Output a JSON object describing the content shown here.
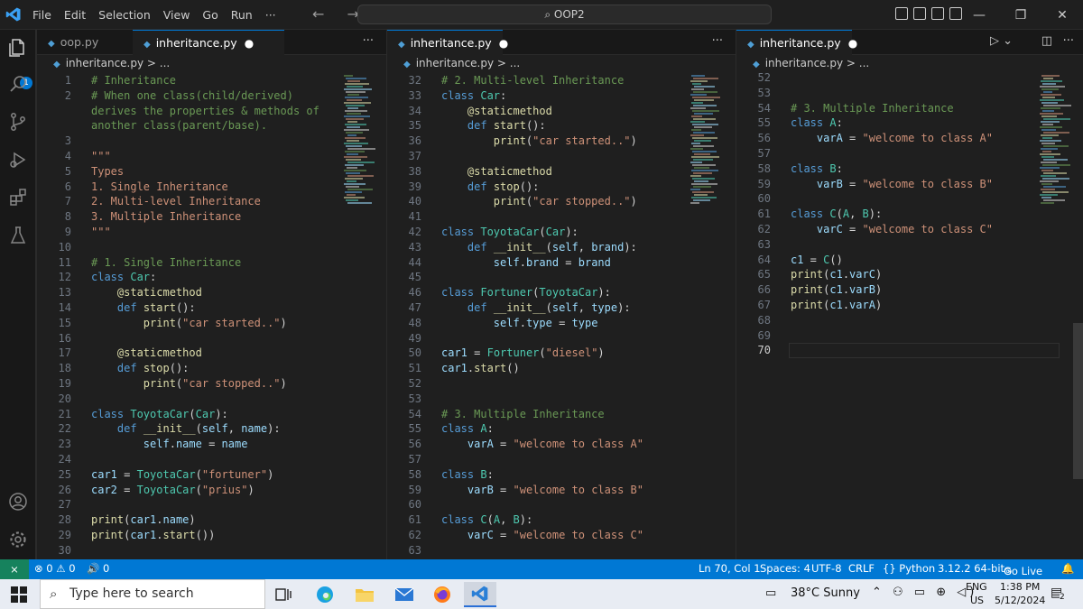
{
  "titlebar": {
    "menu": [
      "File",
      "Edit",
      "Selection",
      "View",
      "Go",
      "Run",
      "···"
    ],
    "search_text": "OOP2",
    "nav_arrows": "← →",
    "window_controls": [
      "—",
      "❐",
      "✕"
    ]
  },
  "activity_bar": {
    "explorer_badge": "1",
    "icons": [
      "files-icon",
      "search-icon",
      "source-control-icon",
      "run-debug-icon",
      "extensions-icon",
      "testing-icon",
      "account-icon",
      "settings-gear-icon"
    ]
  },
  "groups": [
    {
      "tabs": [
        {
          "label": "oop.py",
          "active": false,
          "dirty": false
        },
        {
          "label": "inheritance.py",
          "active": true,
          "dirty": true
        }
      ],
      "breadcrumb": "inheritance.py > ..."
    },
    {
      "tabs": [
        {
          "label": "inheritance.py",
          "active": true,
          "dirty": true
        }
      ],
      "breadcrumb": "inheritance.py > ..."
    },
    {
      "tabs": [
        {
          "label": "inheritance.py",
          "active": true,
          "dirty": true
        }
      ],
      "breadcrumb": "inheritance.py > ..."
    }
  ],
  "editor1_lines": [
    {
      "n": "1",
      "t": [
        [
          "c-cmt",
          "# Inheritance"
        ]
      ]
    },
    {
      "n": "2",
      "t": [
        [
          "c-cmt",
          "# When one class(child/derived)"
        ]
      ]
    },
    {
      "n": "",
      "t": [
        [
          "c-cmt",
          "derives the properties & methods of"
        ]
      ]
    },
    {
      "n": "",
      "t": [
        [
          "c-cmt",
          "another class(parent/base)."
        ]
      ]
    },
    {
      "n": "3",
      "t": []
    },
    {
      "n": "4",
      "t": [
        [
          "c-str",
          "\"\"\""
        ]
      ]
    },
    {
      "n": "5",
      "t": [
        [
          "c-str",
          "Types"
        ]
      ]
    },
    {
      "n": "6",
      "t": [
        [
          "c-str",
          "1. Single Inheritance"
        ]
      ]
    },
    {
      "n": "7",
      "t": [
        [
          "c-str",
          "2. Multi-level Inheritance"
        ]
      ]
    },
    {
      "n": "8",
      "t": [
        [
          "c-str",
          "3. Multiple Inheritance"
        ]
      ]
    },
    {
      "n": "9",
      "t": [
        [
          "c-str",
          "\"\"\""
        ]
      ]
    },
    {
      "n": "10",
      "t": []
    },
    {
      "n": "11",
      "t": [
        [
          "c-cmt",
          "# 1. Single Inheritance"
        ]
      ]
    },
    {
      "n": "12",
      "t": [
        [
          "c-kw",
          "class "
        ],
        [
          "c-cls",
          "Car"
        ],
        [
          "c-txt",
          ":"
        ]
      ]
    },
    {
      "n": "13",
      "t": [
        [
          "c-txt",
          "    "
        ],
        [
          "c-dec",
          "@staticmethod"
        ]
      ]
    },
    {
      "n": "14",
      "t": [
        [
          "c-txt",
          "    "
        ],
        [
          "c-kw",
          "def "
        ],
        [
          "c-fn",
          "start"
        ],
        [
          "c-txt",
          "():"
        ]
      ]
    },
    {
      "n": "15",
      "t": [
        [
          "c-txt",
          "        "
        ],
        [
          "c-fn",
          "print"
        ],
        [
          "c-txt",
          "("
        ],
        [
          "c-str",
          "\"car started..\""
        ],
        [
          "c-txt",
          ")"
        ]
      ]
    },
    {
      "n": "16",
      "t": []
    },
    {
      "n": "17",
      "t": [
        [
          "c-txt",
          "    "
        ],
        [
          "c-dec",
          "@staticmethod"
        ]
      ]
    },
    {
      "n": "18",
      "t": [
        [
          "c-txt",
          "    "
        ],
        [
          "c-kw",
          "def "
        ],
        [
          "c-fn",
          "stop"
        ],
        [
          "c-txt",
          "():"
        ]
      ]
    },
    {
      "n": "19",
      "t": [
        [
          "c-txt",
          "        "
        ],
        [
          "c-fn",
          "print"
        ],
        [
          "c-txt",
          "("
        ],
        [
          "c-str",
          "\"car stopped..\""
        ],
        [
          "c-txt",
          ")"
        ]
      ]
    },
    {
      "n": "20",
      "t": []
    },
    {
      "n": "21",
      "t": [
        [
          "c-kw",
          "class "
        ],
        [
          "c-cls",
          "ToyotaCar"
        ],
        [
          "c-txt",
          "("
        ],
        [
          "c-cls",
          "Car"
        ],
        [
          "c-txt",
          "):"
        ]
      ]
    },
    {
      "n": "22",
      "t": [
        [
          "c-txt",
          "    "
        ],
        [
          "c-kw",
          "def "
        ],
        [
          "c-fn",
          "__init__"
        ],
        [
          "c-txt",
          "("
        ],
        [
          "c-var",
          "self"
        ],
        [
          "c-txt",
          ", "
        ],
        [
          "c-var",
          "name"
        ],
        [
          "c-txt",
          "):"
        ]
      ]
    },
    {
      "n": "23",
      "t": [
        [
          "c-txt",
          "        "
        ],
        [
          "c-var",
          "self"
        ],
        [
          "c-txt",
          "."
        ],
        [
          "c-var",
          "name"
        ],
        [
          "c-txt",
          " = "
        ],
        [
          "c-var",
          "name"
        ]
      ]
    },
    {
      "n": "24",
      "t": []
    },
    {
      "n": "25",
      "t": [
        [
          "c-var",
          "car1"
        ],
        [
          "c-txt",
          " = "
        ],
        [
          "c-cls",
          "ToyotaCar"
        ],
        [
          "c-txt",
          "("
        ],
        [
          "c-str",
          "\"fortuner\""
        ],
        [
          "c-txt",
          ")"
        ]
      ]
    },
    {
      "n": "26",
      "t": [
        [
          "c-var",
          "car2"
        ],
        [
          "c-txt",
          " = "
        ],
        [
          "c-cls",
          "ToyotaCar"
        ],
        [
          "c-txt",
          "("
        ],
        [
          "c-str",
          "\"prius\""
        ],
        [
          "c-txt",
          ")"
        ]
      ]
    },
    {
      "n": "27",
      "t": []
    },
    {
      "n": "28",
      "t": [
        [
          "c-fn",
          "print"
        ],
        [
          "c-txt",
          "("
        ],
        [
          "c-var",
          "car1"
        ],
        [
          "c-txt",
          "."
        ],
        [
          "c-var",
          "name"
        ],
        [
          "c-txt",
          ")"
        ]
      ]
    },
    {
      "n": "29",
      "t": [
        [
          "c-fn",
          "print"
        ],
        [
          "c-txt",
          "("
        ],
        [
          "c-var",
          "car1"
        ],
        [
          "c-txt",
          "."
        ],
        [
          "c-fn",
          "start"
        ],
        [
          "c-txt",
          "())"
        ]
      ]
    },
    {
      "n": "30",
      "t": []
    }
  ],
  "editor2_lines": [
    {
      "n": "32",
      "t": [
        [
          "c-cmt",
          "# 2. Multi-level Inheritance"
        ]
      ]
    },
    {
      "n": "33",
      "t": [
        [
          "c-kw",
          "class "
        ],
        [
          "c-cls",
          "Car"
        ],
        [
          "c-txt",
          ":"
        ]
      ]
    },
    {
      "n": "34",
      "t": [
        [
          "c-txt",
          "    "
        ],
        [
          "c-dec",
          "@staticmethod"
        ]
      ]
    },
    {
      "n": "35",
      "t": [
        [
          "c-txt",
          "    "
        ],
        [
          "c-kw",
          "def "
        ],
        [
          "c-fn",
          "start"
        ],
        [
          "c-txt",
          "():"
        ]
      ]
    },
    {
      "n": "36",
      "t": [
        [
          "c-txt",
          "        "
        ],
        [
          "c-fn",
          "print"
        ],
        [
          "c-txt",
          "("
        ],
        [
          "c-str",
          "\"car started..\""
        ],
        [
          "c-txt",
          ")"
        ]
      ]
    },
    {
      "n": "37",
      "t": []
    },
    {
      "n": "38",
      "t": [
        [
          "c-txt",
          "    "
        ],
        [
          "c-dec",
          "@staticmethod"
        ]
      ]
    },
    {
      "n": "39",
      "t": [
        [
          "c-txt",
          "    "
        ],
        [
          "c-kw",
          "def "
        ],
        [
          "c-fn",
          "stop"
        ],
        [
          "c-txt",
          "():"
        ]
      ]
    },
    {
      "n": "40",
      "t": [
        [
          "c-txt",
          "        "
        ],
        [
          "c-fn",
          "print"
        ],
        [
          "c-txt",
          "("
        ],
        [
          "c-str",
          "\"car stopped..\""
        ],
        [
          "c-txt",
          ")"
        ]
      ]
    },
    {
      "n": "41",
      "t": []
    },
    {
      "n": "42",
      "t": [
        [
          "c-kw",
          "class "
        ],
        [
          "c-cls",
          "ToyotaCar"
        ],
        [
          "c-txt",
          "("
        ],
        [
          "c-cls",
          "Car"
        ],
        [
          "c-txt",
          "):"
        ]
      ]
    },
    {
      "n": "43",
      "t": [
        [
          "c-txt",
          "    "
        ],
        [
          "c-kw",
          "def "
        ],
        [
          "c-fn",
          "__init__"
        ],
        [
          "c-txt",
          "("
        ],
        [
          "c-var",
          "self"
        ],
        [
          "c-txt",
          ", "
        ],
        [
          "c-var",
          "brand"
        ],
        [
          "c-txt",
          "):"
        ]
      ]
    },
    {
      "n": "44",
      "t": [
        [
          "c-txt",
          "        "
        ],
        [
          "c-var",
          "self"
        ],
        [
          "c-txt",
          "."
        ],
        [
          "c-var",
          "brand"
        ],
        [
          "c-txt",
          " = "
        ],
        [
          "c-var",
          "brand"
        ]
      ]
    },
    {
      "n": "45",
      "t": []
    },
    {
      "n": "46",
      "t": [
        [
          "c-kw",
          "class "
        ],
        [
          "c-cls",
          "Fortuner"
        ],
        [
          "c-txt",
          "("
        ],
        [
          "c-cls",
          "ToyotaCar"
        ],
        [
          "c-txt",
          "):"
        ]
      ]
    },
    {
      "n": "47",
      "t": [
        [
          "c-txt",
          "    "
        ],
        [
          "c-kw",
          "def "
        ],
        [
          "c-fn",
          "__init__"
        ],
        [
          "c-txt",
          "("
        ],
        [
          "c-var",
          "self"
        ],
        [
          "c-txt",
          ", "
        ],
        [
          "c-var",
          "type"
        ],
        [
          "c-txt",
          "):"
        ]
      ]
    },
    {
      "n": "48",
      "t": [
        [
          "c-txt",
          "        "
        ],
        [
          "c-var",
          "self"
        ],
        [
          "c-txt",
          "."
        ],
        [
          "c-var",
          "type"
        ],
        [
          "c-txt",
          " = "
        ],
        [
          "c-var",
          "type"
        ]
      ]
    },
    {
      "n": "49",
      "t": []
    },
    {
      "n": "50",
      "t": [
        [
          "c-var",
          "car1"
        ],
        [
          "c-txt",
          " = "
        ],
        [
          "c-cls",
          "Fortuner"
        ],
        [
          "c-txt",
          "("
        ],
        [
          "c-str",
          "\"diesel\""
        ],
        [
          "c-txt",
          ")"
        ]
      ]
    },
    {
      "n": "51",
      "t": [
        [
          "c-var",
          "car1"
        ],
        [
          "c-txt",
          "."
        ],
        [
          "c-fn",
          "start"
        ],
        [
          "c-txt",
          "()"
        ]
      ]
    },
    {
      "n": "52",
      "t": []
    },
    {
      "n": "53",
      "t": []
    },
    {
      "n": "54",
      "t": [
        [
          "c-cmt",
          "# 3. Multiple Inheritance"
        ]
      ]
    },
    {
      "n": "55",
      "t": [
        [
          "c-kw",
          "class "
        ],
        [
          "c-cls",
          "A"
        ],
        [
          "c-txt",
          ":"
        ]
      ]
    },
    {
      "n": "56",
      "t": [
        [
          "c-txt",
          "    "
        ],
        [
          "c-var",
          "varA"
        ],
        [
          "c-txt",
          " = "
        ],
        [
          "c-str",
          "\"welcome to class A\""
        ]
      ]
    },
    {
      "n": "57",
      "t": []
    },
    {
      "n": "58",
      "t": [
        [
          "c-kw",
          "class "
        ],
        [
          "c-cls",
          "B"
        ],
        [
          "c-txt",
          ":"
        ]
      ]
    },
    {
      "n": "59",
      "t": [
        [
          "c-txt",
          "    "
        ],
        [
          "c-var",
          "varB"
        ],
        [
          "c-txt",
          " = "
        ],
        [
          "c-str",
          "\"welcome to class B\""
        ]
      ]
    },
    {
      "n": "60",
      "t": []
    },
    {
      "n": "61",
      "t": [
        [
          "c-kw",
          "class "
        ],
        [
          "c-cls",
          "C"
        ],
        [
          "c-txt",
          "("
        ],
        [
          "c-cls",
          "A"
        ],
        [
          "c-txt",
          ", "
        ],
        [
          "c-cls",
          "B"
        ],
        [
          "c-txt",
          "):"
        ]
      ]
    },
    {
      "n": "62",
      "t": [
        [
          "c-txt",
          "    "
        ],
        [
          "c-var",
          "varC"
        ],
        [
          "c-txt",
          " = "
        ],
        [
          "c-str",
          "\"welcome to class C\""
        ]
      ]
    },
    {
      "n": "63",
      "t": []
    }
  ],
  "editor3_lines": [
    {
      "n": "52",
      "t": []
    },
    {
      "n": "53",
      "t": []
    },
    {
      "n": "54",
      "t": [
        [
          "c-cmt",
          "# 3. Multiple Inheritance"
        ]
      ]
    },
    {
      "n": "55",
      "t": [
        [
          "c-kw",
          "class "
        ],
        [
          "c-cls",
          "A"
        ],
        [
          "c-txt",
          ":"
        ]
      ]
    },
    {
      "n": "56",
      "t": [
        [
          "c-txt",
          "    "
        ],
        [
          "c-var",
          "varA"
        ],
        [
          "c-txt",
          " = "
        ],
        [
          "c-str",
          "\"welcome to class A\""
        ]
      ]
    },
    {
      "n": "57",
      "t": []
    },
    {
      "n": "58",
      "t": [
        [
          "c-kw",
          "class "
        ],
        [
          "c-cls",
          "B"
        ],
        [
          "c-txt",
          ":"
        ]
      ]
    },
    {
      "n": "59",
      "t": [
        [
          "c-txt",
          "    "
        ],
        [
          "c-var",
          "varB"
        ],
        [
          "c-txt",
          " = "
        ],
        [
          "c-str",
          "\"welcome to class B\""
        ]
      ]
    },
    {
      "n": "60",
      "t": []
    },
    {
      "n": "61",
      "t": [
        [
          "c-kw",
          "class "
        ],
        [
          "c-cls",
          "C"
        ],
        [
          "c-txt",
          "("
        ],
        [
          "c-cls",
          "A"
        ],
        [
          "c-txt",
          ", "
        ],
        [
          "c-cls",
          "B"
        ],
        [
          "c-txt",
          "):"
        ]
      ]
    },
    {
      "n": "62",
      "t": [
        [
          "c-txt",
          "    "
        ],
        [
          "c-var",
          "varC"
        ],
        [
          "c-txt",
          " = "
        ],
        [
          "c-str",
          "\"welcome to class C\""
        ]
      ]
    },
    {
      "n": "63",
      "t": []
    },
    {
      "n": "64",
      "t": [
        [
          "c-var",
          "c1"
        ],
        [
          "c-txt",
          " = "
        ],
        [
          "c-cls",
          "C"
        ],
        [
          "c-txt",
          "()"
        ]
      ]
    },
    {
      "n": "65",
      "t": [
        [
          "c-fn",
          "print"
        ],
        [
          "c-txt",
          "("
        ],
        [
          "c-var",
          "c1"
        ],
        [
          "c-txt",
          "."
        ],
        [
          "c-var",
          "varC"
        ],
        [
          "c-txt",
          ")"
        ]
      ]
    },
    {
      "n": "66",
      "t": [
        [
          "c-fn",
          "print"
        ],
        [
          "c-txt",
          "("
        ],
        [
          "c-var",
          "c1"
        ],
        [
          "c-txt",
          "."
        ],
        [
          "c-var",
          "varB"
        ],
        [
          "c-txt",
          ")"
        ]
      ]
    },
    {
      "n": "67",
      "t": [
        [
          "c-fn",
          "print"
        ],
        [
          "c-txt",
          "("
        ],
        [
          "c-var",
          "c1"
        ],
        [
          "c-txt",
          "."
        ],
        [
          "c-var",
          "varA"
        ],
        [
          "c-txt",
          ")"
        ]
      ]
    },
    {
      "n": "68",
      "t": []
    },
    {
      "n": "69",
      "t": []
    },
    {
      "n": "70",
      "t": [],
      "current": true
    }
  ],
  "statusbar": {
    "problems": "⊗ 0 ⚠ 0",
    "ports": "🔊 0",
    "position": "Ln 70, Col 1",
    "spaces": "Spaces: 4",
    "encoding": "UTF-8",
    "eol": "CRLF",
    "language": "{} Python",
    "interpreter": "3.12.2 64-bit",
    "golive": "Go Live"
  },
  "taskbar": {
    "search_placeholder": "Type here to search",
    "weather": "38°C  Sunny",
    "lang": "ENG",
    "region": "US",
    "time": "1:38 PM",
    "date": "5/12/2024",
    "notifications": "2"
  },
  "colors": {
    "accent": "#0078d4",
    "statusbar": "#0078d4",
    "editor_bg": "#1f1f1f"
  }
}
